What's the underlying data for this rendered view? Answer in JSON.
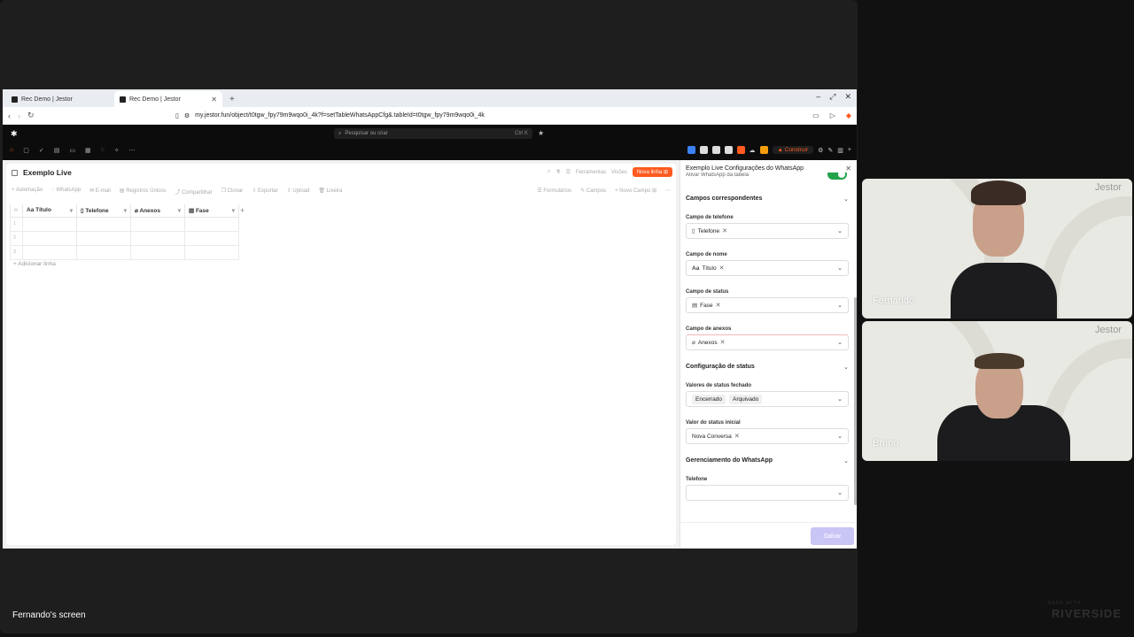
{
  "browser": {
    "tabs": [
      {
        "label": "Rec Demo | Jestor"
      },
      {
        "label": "Rec Demo | Jestor"
      }
    ],
    "url": "my.jestor.fun/object/t0tgw_fpy79m9wqo0i_4k?f=setTableWhatsAppCfg&.tableId=t0tgw_fpy79m9wqo0i_4k"
  },
  "app": {
    "search_placeholder": "Pesquisar ou criar",
    "search_shortcut": "Ctrl K",
    "construir_label": "Construir"
  },
  "table": {
    "title": "Exemplo Live",
    "actions": [
      "Ferramentas",
      "Visões"
    ],
    "new_row_label": "Nova linha",
    "toolbar": [
      "Automação",
      "WhatsApp",
      "E-mail",
      "Registros Únicos",
      "Compartilhar",
      "Clonar",
      "Exportar",
      "Upload",
      "Lixeira"
    ],
    "toolbar_right": [
      "Formulários",
      "Campos",
      "Novo Campo"
    ],
    "columns": [
      "Título",
      "Telefone",
      "Anexos",
      "Fase"
    ],
    "rows": [
      "1",
      "2",
      "3"
    ],
    "add_row_label": "Adicionar linha"
  },
  "panel": {
    "title": "Exemplo Live Configurações do WhatsApp",
    "toggle_label": "Ativar WhatsApp da tabela",
    "toggle_on": true,
    "section_fields": "Campos correspondentes",
    "phone_field_label": "Campo de telefone",
    "phone_field_value": "Telefone",
    "name_field_label": "Campo de nome",
    "name_field_value": "Título",
    "status_field_label": "Campo de status",
    "status_field_value": "Fase",
    "attach_field_label": "Campo de anexos",
    "attach_field_value": "Anexos",
    "section_status": "Configuração de status",
    "closed_label": "Valores de status fechado",
    "closed_values": [
      "Encerrado",
      "Arquivado"
    ],
    "initial_label": "Valor do status inicial",
    "initial_value": "Nova Conversa",
    "section_manage": "Gerenciamento do WhatsApp",
    "phone_label": "Telefone",
    "save_label": "Salvar"
  },
  "call": {
    "screen_caption": "Fernando's screen",
    "participants": [
      {
        "name": "Fernando",
        "brand": "Jestor"
      },
      {
        "name": "Bruno",
        "brand": "Jestor"
      }
    ],
    "watermark": "RIVERSIDE",
    "watermark_sub": "MADE WITH"
  },
  "colors": {
    "accent": "#ff5a1f",
    "toggle": "#21a34a",
    "save_disabled": "#c9c5f5"
  }
}
